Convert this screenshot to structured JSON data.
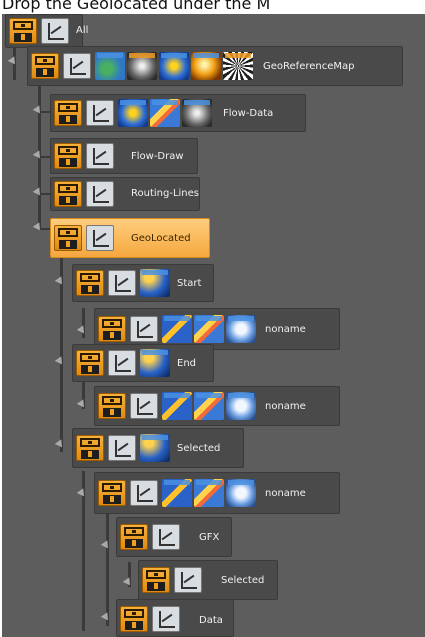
{
  "caption": "Drop the Geolocated under the M",
  "nodes": [
    {
      "label": "All"
    },
    {
      "label": "GeoReferenceMap"
    },
    {
      "label": "Flow-Data"
    },
    {
      "label": "Flow-Draw"
    },
    {
      "label": "Routing-Lines"
    },
    {
      "label": "GeoLocated"
    },
    {
      "label": "Start"
    },
    {
      "label": "noname"
    },
    {
      "label": "End"
    },
    {
      "label": "noname"
    },
    {
      "label": "Selected"
    },
    {
      "label": "noname"
    },
    {
      "label": "GFX"
    },
    {
      "label": "Selected"
    },
    {
      "label": "Data"
    }
  ],
  "selected_node": "GeoLocated",
  "colors": {
    "background": "#5d5d5d",
    "node": "#4a4a4a",
    "selected": "#f5a73e",
    "group_icon": "#f1a020"
  },
  "icons": {
    "group": "group-container-icon",
    "axes": "transform-axes-icon"
  }
}
